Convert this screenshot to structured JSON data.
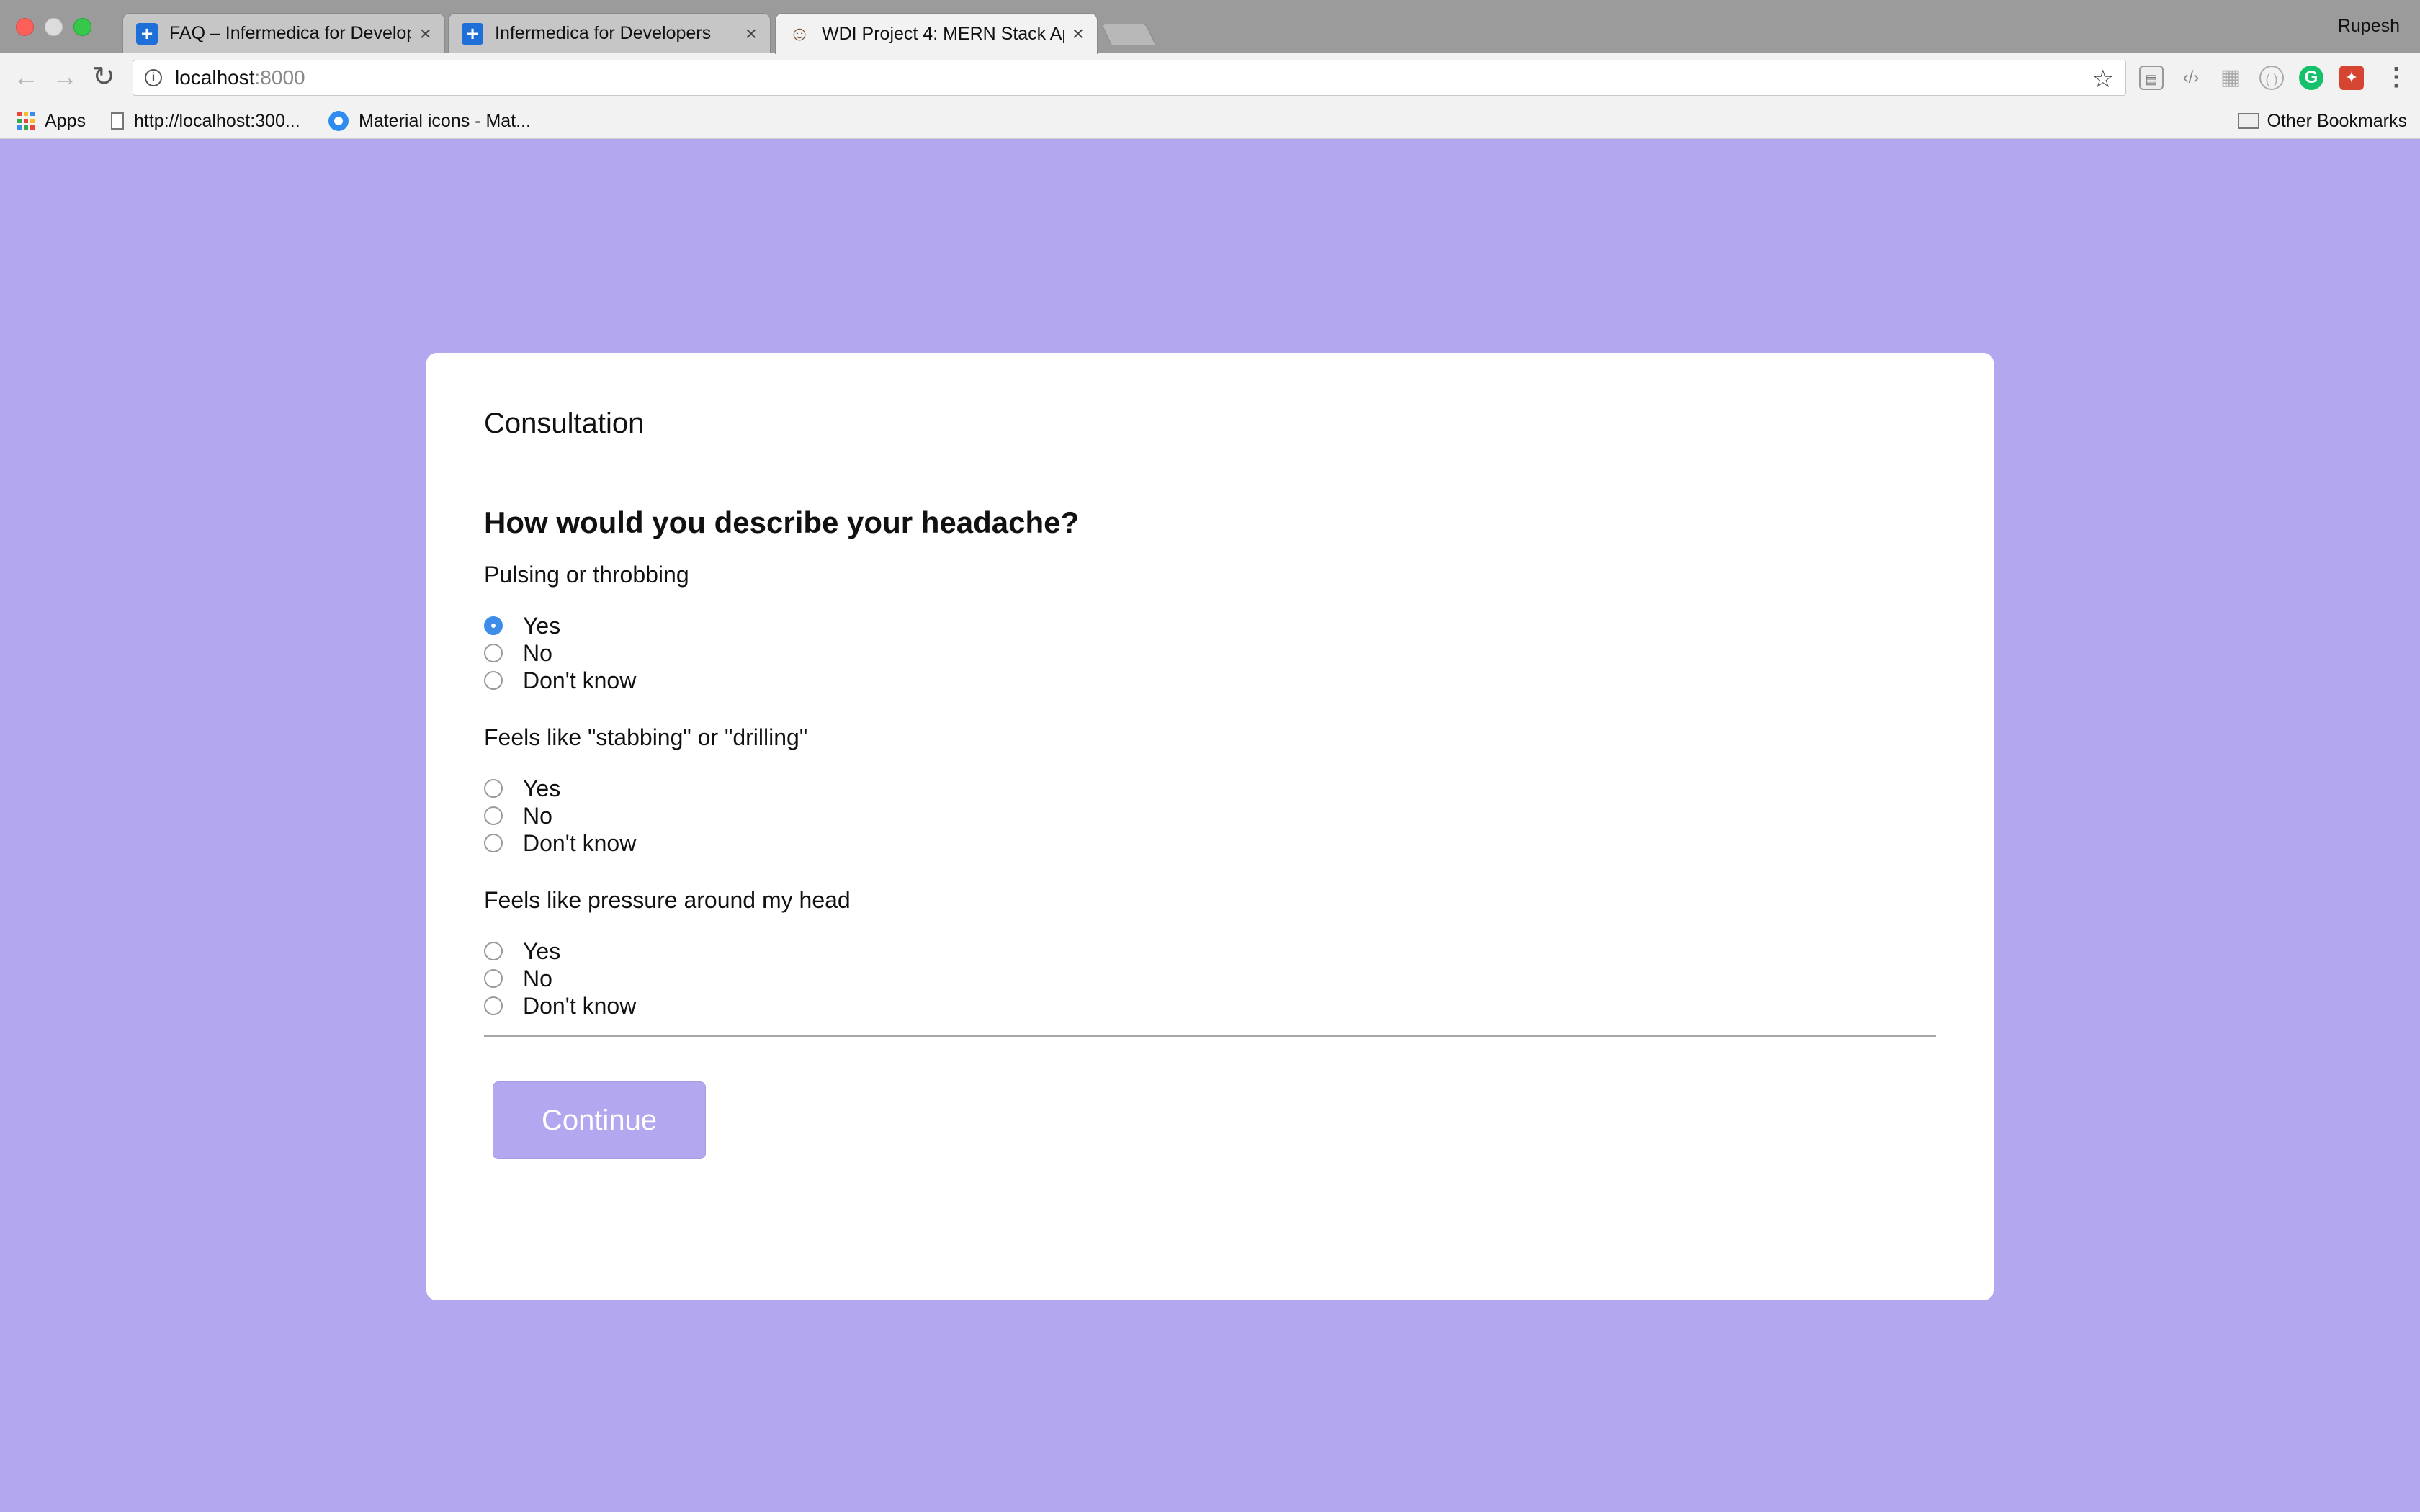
{
  "browser": {
    "tabs": [
      {
        "title": "FAQ – Infermedica for Develop",
        "close": "×"
      },
      {
        "title": "Infermedica for Developers",
        "close": "×"
      },
      {
        "title": "WDI Project 4: MERN Stack Ap",
        "close": "×"
      }
    ],
    "profile_name": "Rupesh",
    "url_host": "localhost",
    "url_port": ":8000",
    "bookmarks": {
      "apps": "Apps",
      "localhost": "http://localhost:300...",
      "material": "Material icons - Mat...",
      "other": "Other Bookmarks"
    },
    "icons": [
      "back-arrow-icon",
      "forward-arrow-icon",
      "reload-icon",
      "info-icon",
      "star-icon",
      "menu-icon"
    ]
  },
  "consultation": {
    "title": "Consultation",
    "question": "How would you describe your headache?",
    "symptoms": [
      {
        "label": "Pulsing or throbbing",
        "options": [
          "Yes",
          "No",
          "Don't know"
        ],
        "selected": "Yes"
      },
      {
        "label": "Feels like \"stabbing\" or \"drilling\"",
        "options": [
          "Yes",
          "No",
          "Don't know"
        ],
        "selected": null
      },
      {
        "label": "Feels like pressure around my head",
        "options": [
          "Yes",
          "No",
          "Don't know"
        ],
        "selected": null
      }
    ],
    "continue_label": "Continue"
  },
  "colors": {
    "page_background": "#b3a8f0",
    "radio_checked": "#3c8ce8",
    "button": "#b3a8f0"
  }
}
